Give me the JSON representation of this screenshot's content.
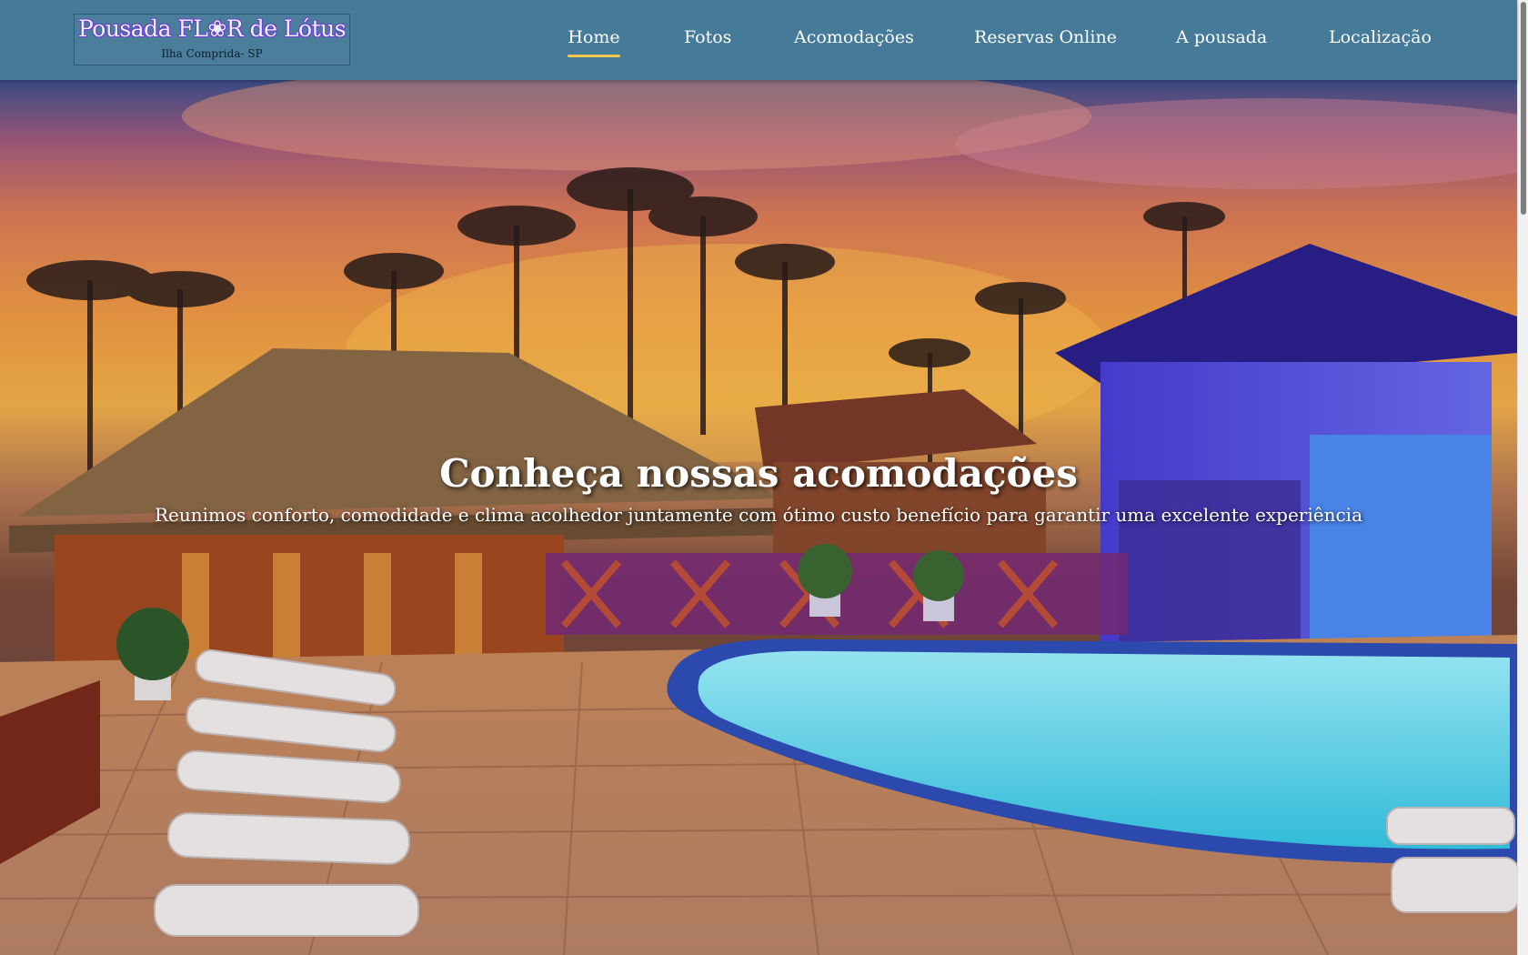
{
  "logo": {
    "title": "Pousada FL❀R de Lótus",
    "subtitle": "Ilha Comprida- SP"
  },
  "nav": {
    "items": [
      {
        "label": "Home",
        "active": true
      },
      {
        "label": "Fotos",
        "active": false
      },
      {
        "label": "Acomodações",
        "active": false
      },
      {
        "label": "Reservas Online",
        "active": false
      },
      {
        "label": "A pousada",
        "active": false
      },
      {
        "label": "Localização",
        "active": false
      }
    ]
  },
  "hero": {
    "title": "Conheça nossas acomodações",
    "subtitle": "Reunimos conforto, comodidade e clima acolhedor juntamente com ótimo custo benefício para garantir uma excelente experiência",
    "image": "sunset-pool-resort-photo"
  },
  "colors": {
    "navbar": "#457a98",
    "active_underline": "#f2c94c",
    "text": "#ffffff"
  }
}
